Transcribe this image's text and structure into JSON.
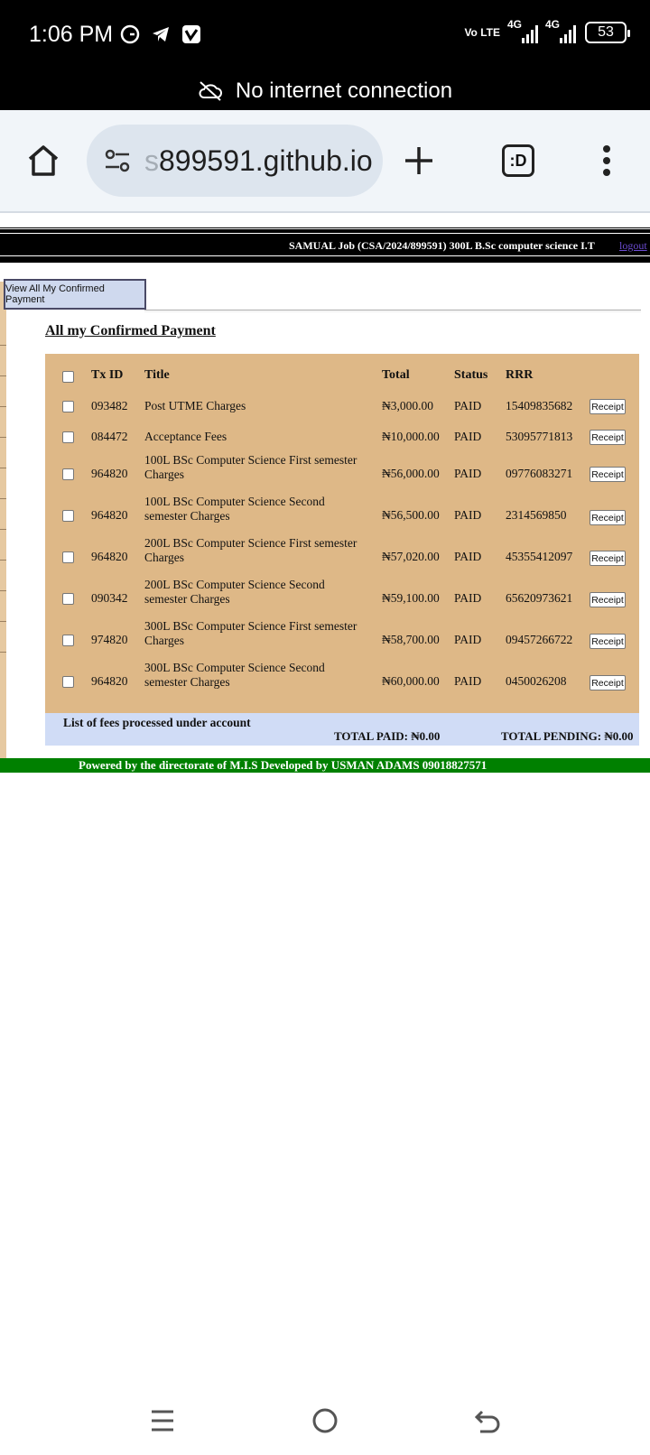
{
  "status_bar": {
    "time": "1:06 PM",
    "volte": "Vo LTE",
    "network1": "4G",
    "network2": "4G",
    "battery": "53"
  },
  "offline_banner": {
    "text": "No internet connection"
  },
  "browser": {
    "url_faded": "s",
    "url": "899591.github.io",
    "tabs_label": ":D"
  },
  "header": {
    "user_line": "SAMUAL  Job   (CSA/2024/899591)    300L B.Sc computer science I.T",
    "logout": "logout"
  },
  "view_button": "View All My Confirmed Payment",
  "heading": "All my Confirmed Payment",
  "table": {
    "columns": [
      "Tx ID",
      "Title",
      "Total",
      "Status",
      "RRR"
    ],
    "receipt_label": "Receipt",
    "rows": [
      {
        "tx_id": "093482",
        "title": "Post UTME Charges",
        "total": "₦3,000.00",
        "status": "PAID",
        "rrr": "15409835682"
      },
      {
        "tx_id": "084472",
        "title": "Acceptance Fees",
        "total": "₦10,000.00",
        "status": "PAID",
        "rrr": "53095771813"
      },
      {
        "tx_id": "964820",
        "title": "100L BSc Computer Science First semester Charges",
        "total": "₦56,000.00",
        "status": "PAID",
        "rrr": "09776083271"
      },
      {
        "tx_id": "964820",
        "title": "100L BSc Computer Science Second semester Charges",
        "total": "₦56,500.00",
        "status": "PAID",
        "rrr": "2314569850"
      },
      {
        "tx_id": "964820",
        "title": "200L BSc Computer Science First semester Charges",
        "total": "₦57,020.00",
        "status": "PAID",
        "rrr": "45355412097"
      },
      {
        "tx_id": "090342",
        "title": "200L BSc Computer Science Second semester Charges",
        "total": "₦59,100.00",
        "status": "PAID",
        "rrr": "65620973621"
      },
      {
        "tx_id": "974820",
        "title": "300L BSc Computer Science First semester Charges",
        "total": "₦58,700.00",
        "status": "PAID",
        "rrr": "09457266722"
      },
      {
        "tx_id": "964820",
        "title": "300L BSc Computer Science Second semester Charges",
        "total": "₦60,000.00",
        "status": "PAID",
        "rrr": "0450026208"
      }
    ]
  },
  "footer": {
    "label": "List of fees processed under account",
    "total_paid": "TOTAL PAID: ₦0.00",
    "total_pending": "TOTAL PENDING: ₦0.00"
  },
  "credits": "Powered by the directorate of   M.I.S   Developed   by    USMAN ADAMS   09018827571",
  "colors": {
    "table_bg": "#deb887",
    "footer_bg": "#d0dcf6",
    "credits_bg": "#008000",
    "header_bg": "#000000"
  }
}
